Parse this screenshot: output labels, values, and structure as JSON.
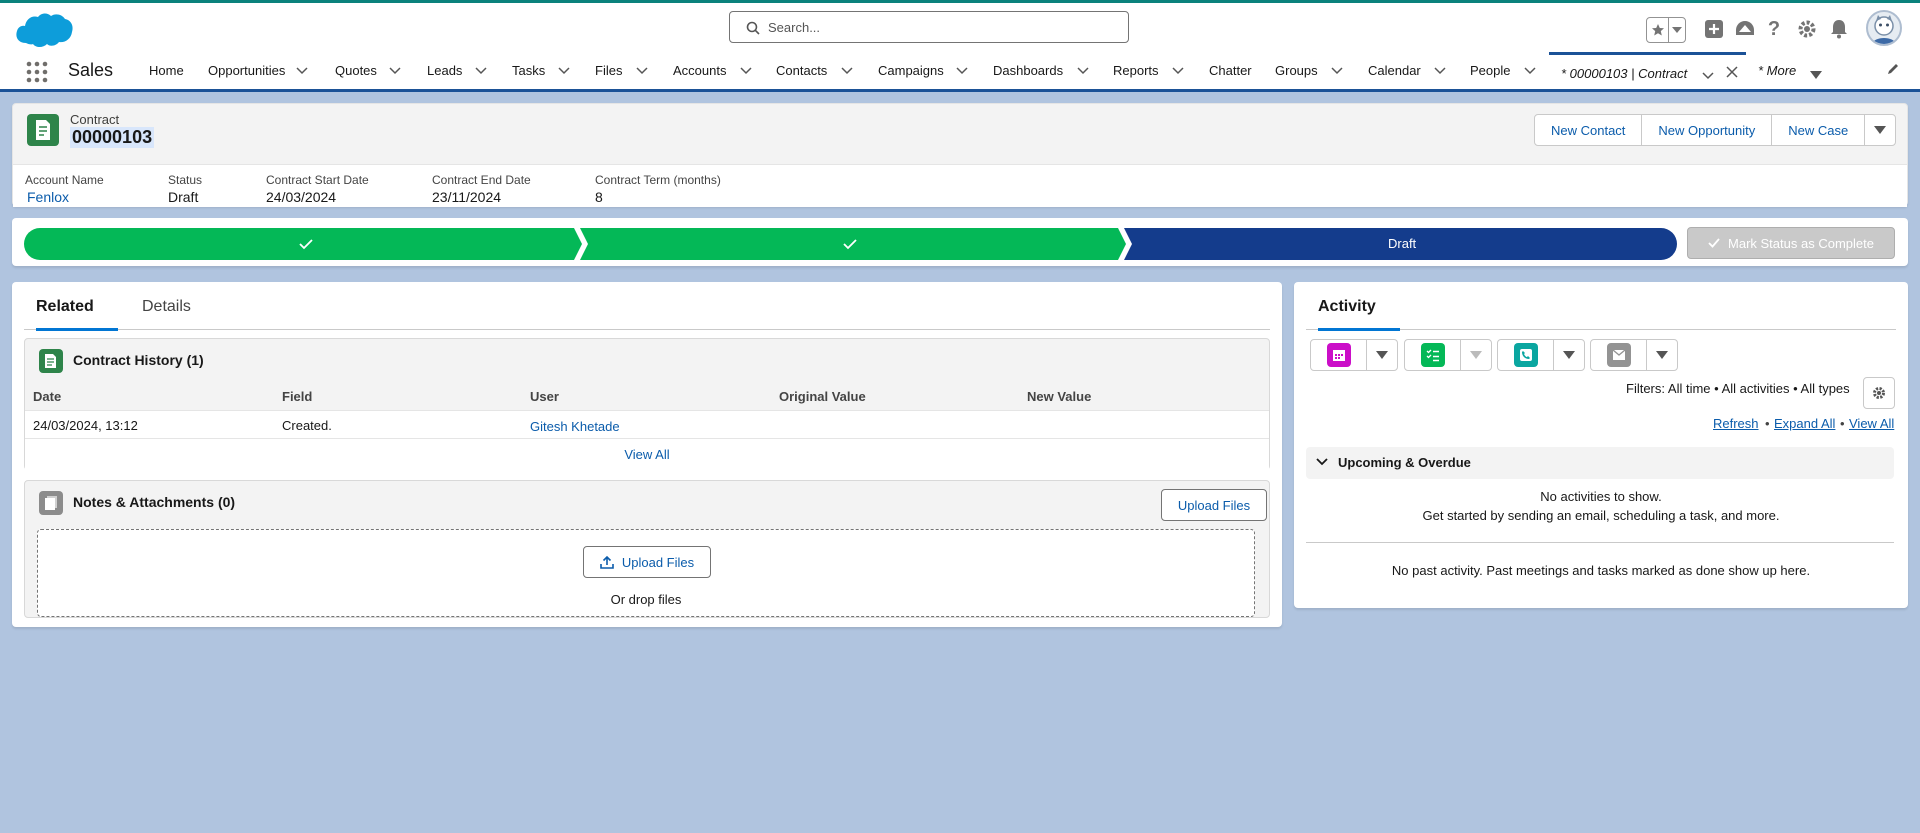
{
  "app": {
    "name": "Sales"
  },
  "search": {
    "placeholder": "Search..."
  },
  "nav": {
    "items": [
      {
        "label": "Home"
      },
      {
        "label": "Opportunities"
      },
      {
        "label": "Quotes"
      },
      {
        "label": "Leads"
      },
      {
        "label": "Tasks"
      },
      {
        "label": "Files"
      },
      {
        "label": "Accounts"
      },
      {
        "label": "Contacts"
      },
      {
        "label": "Campaigns"
      },
      {
        "label": "Dashboards"
      },
      {
        "label": "Reports"
      },
      {
        "label": "Chatter"
      },
      {
        "label": "Groups"
      },
      {
        "label": "Calendar"
      },
      {
        "label": "People"
      }
    ],
    "active_tab": "* 00000103 | Contract",
    "more": "* More"
  },
  "record": {
    "type": "Contract",
    "title": "00000103",
    "actions": [
      "New Contact",
      "New Opportunity",
      "New Case"
    ],
    "fields": [
      {
        "label": "Account Name",
        "value": "Fenlox"
      },
      {
        "label": "Status",
        "value": "Draft"
      },
      {
        "label": "Contract Start Date",
        "value": "24/03/2024"
      },
      {
        "label": "Contract End Date",
        "value": "23/11/2024"
      },
      {
        "label": "Contract Term (months)",
        "value": "8"
      }
    ]
  },
  "path": {
    "current": "Draft",
    "mark_button": "Mark Status as Complete",
    "colors": {
      "complete": "#04b857",
      "current": "#143c8c"
    }
  },
  "related": {
    "tabs": [
      "Related",
      "Details"
    ],
    "contract_history": {
      "title": "Contract History (1)",
      "columns": [
        "Date",
        "Field",
        "User",
        "Original Value",
        "New Value"
      ],
      "rows": [
        {
          "date": "24/03/2024, 13:12",
          "field": "Created.",
          "user": "Gitesh Khetade",
          "original": "",
          "new": ""
        }
      ],
      "view_all": "View All"
    },
    "notes": {
      "title": "Notes & Attachments (0)",
      "upload_button": "Upload Files",
      "drop_upload": "Upload Files",
      "drop_text": "Or drop files"
    }
  },
  "activity": {
    "title": "Activity",
    "filters": "Filters: All time • All activities • All types",
    "links": [
      "Refresh",
      "Expand All",
      "View All"
    ],
    "upcoming_title": "Upcoming & Overdue",
    "no_activities": "No activities to show.",
    "get_started": "Get started by sending an email, scheduling a task, and more.",
    "no_past": "No past activity. Past meetings and tasks marked as done show up here."
  },
  "colors": {
    "brand": "#0176d3",
    "link": "#0b5cab",
    "event": "#cb0ec8",
    "task": "#04b857",
    "call": "#0aa6a0",
    "email": "#939393"
  }
}
